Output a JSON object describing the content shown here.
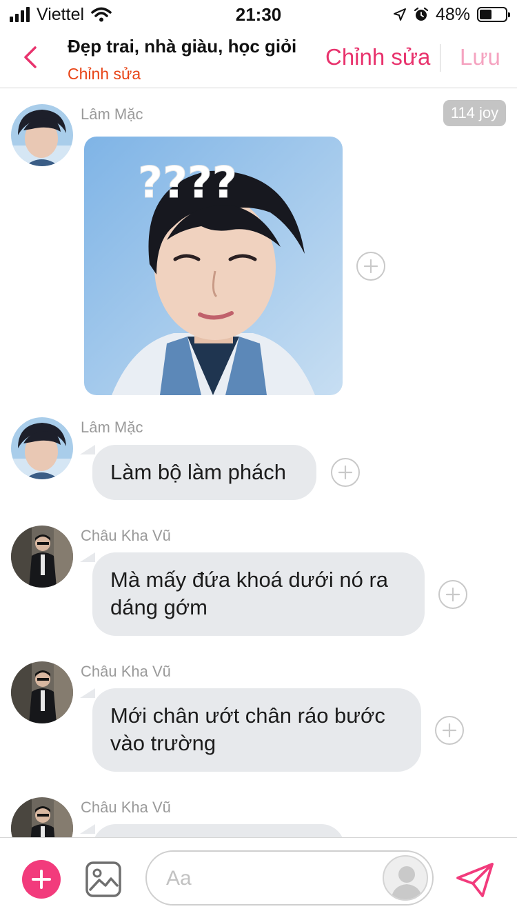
{
  "status_bar": {
    "carrier": "Viettel",
    "time": "21:30",
    "battery_percent": "48%",
    "battery_level": 0.48
  },
  "header": {
    "title": "Đẹp trai, nhà giàu, học giỏi",
    "subtitle": "Chỉnh sửa",
    "edit_label": "Chỉnh sửa",
    "save_label": "Lưu"
  },
  "chat": {
    "joy_badge": "114 joy",
    "messages": [
      {
        "sender": "Lâm Mặc",
        "type": "image",
        "image_text": "????"
      },
      {
        "sender": "Lâm Mặc",
        "type": "text",
        "text": "Làm bộ làm phách"
      },
      {
        "sender": "Châu Kha Vũ",
        "type": "text",
        "text": "Mà mấy đứa khoá dưới nó ra dáng gớm"
      },
      {
        "sender": "Châu Kha Vũ",
        "type": "text",
        "text": "Mới chân ướt chân ráo bước vào trường"
      },
      {
        "sender": "Châu Kha Vũ",
        "type": "text",
        "text": ""
      }
    ]
  },
  "composer": {
    "placeholder": "Aa"
  },
  "colors": {
    "accent": "#f23b7c",
    "edit_text": "#e8336d",
    "save_text": "#f5a3c0",
    "subtitle": "#e84416",
    "bubble": "#e7e9ec"
  },
  "icons": {
    "back": "chevron-left-icon",
    "add": "plus-icon",
    "image": "image-gallery-icon",
    "send": "paper-plane-icon",
    "react": "plus-circle-icon"
  }
}
